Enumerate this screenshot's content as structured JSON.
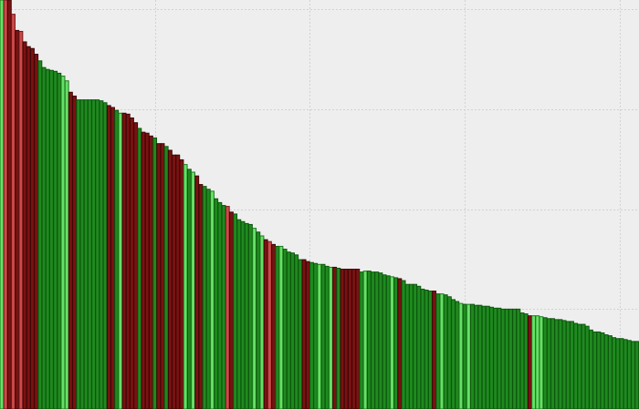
{
  "chart_data": {
    "type": "bar",
    "title": "",
    "xlabel": "",
    "ylabel": "",
    "ylim": [
      0,
      430
    ],
    "xlim": [
      0,
      165
    ],
    "grid": true,
    "x_grid_values": [
      0,
      40,
      80,
      120,
      160
    ],
    "y_grid_values": [
      105,
      210,
      315,
      420
    ],
    "legend": "none",
    "palette": {
      "dark_green": "#1f8a1f",
      "light_green": "#66e066",
      "dark_red": "#7a1212",
      "light_red": "#cc4a4a"
    },
    "bars": [
      {
        "value": 447,
        "color": "light_green"
      },
      {
        "value": 440,
        "color": "light_red"
      },
      {
        "value": 430,
        "color": "dark_red"
      },
      {
        "value": 415,
        "color": "light_red"
      },
      {
        "value": 398,
        "color": "dark_red"
      },
      {
        "value": 397,
        "color": "light_red"
      },
      {
        "value": 386,
        "color": "dark_red"
      },
      {
        "value": 381,
        "color": "dark_red"
      },
      {
        "value": 379,
        "color": "dark_red"
      },
      {
        "value": 373,
        "color": "dark_red"
      },
      {
        "value": 366,
        "color": "dark_green"
      },
      {
        "value": 359,
        "color": "dark_green"
      },
      {
        "value": 357,
        "color": "dark_green"
      },
      {
        "value": 356,
        "color": "dark_green"
      },
      {
        "value": 355,
        "color": "dark_green"
      },
      {
        "value": 353,
        "color": "dark_green"
      },
      {
        "value": 350,
        "color": "light_green"
      },
      {
        "value": 345,
        "color": "light_green"
      },
      {
        "value": 333,
        "color": "dark_red"
      },
      {
        "value": 329,
        "color": "dark_red"
      },
      {
        "value": 325,
        "color": "dark_green"
      },
      {
        "value": 325,
        "color": "dark_green"
      },
      {
        "value": 325,
        "color": "dark_green"
      },
      {
        "value": 325,
        "color": "dark_green"
      },
      {
        "value": 325,
        "color": "dark_green"
      },
      {
        "value": 325,
        "color": "dark_green"
      },
      {
        "value": 324,
        "color": "dark_green"
      },
      {
        "value": 322,
        "color": "dark_green"
      },
      {
        "value": 319,
        "color": "dark_red"
      },
      {
        "value": 317,
        "color": "dark_red"
      },
      {
        "value": 314,
        "color": "dark_green"
      },
      {
        "value": 311,
        "color": "light_green"
      },
      {
        "value": 311,
        "color": "dark_red"
      },
      {
        "value": 310,
        "color": "dark_red"
      },
      {
        "value": 306,
        "color": "dark_red"
      },
      {
        "value": 301,
        "color": "dark_red"
      },
      {
        "value": 295,
        "color": "dark_green"
      },
      {
        "value": 291,
        "color": "dark_red"
      },
      {
        "value": 290,
        "color": "dark_red"
      },
      {
        "value": 287,
        "color": "dark_red"
      },
      {
        "value": 285,
        "color": "dark_green"
      },
      {
        "value": 279,
        "color": "dark_red"
      },
      {
        "value": 279,
        "color": "dark_red"
      },
      {
        "value": 276,
        "color": "dark_green"
      },
      {
        "value": 272,
        "color": "dark_red"
      },
      {
        "value": 267,
        "color": "dark_red"
      },
      {
        "value": 267,
        "color": "dark_red"
      },
      {
        "value": 262,
        "color": "dark_red"
      },
      {
        "value": 257,
        "color": "light_green"
      },
      {
        "value": 252,
        "color": "dark_green"
      },
      {
        "value": 249,
        "color": "light_green"
      },
      {
        "value": 245,
        "color": "dark_red"
      },
      {
        "value": 236,
        "color": "dark_red"
      },
      {
        "value": 234,
        "color": "dark_green"
      },
      {
        "value": 231,
        "color": "dark_green"
      },
      {
        "value": 229,
        "color": "light_green"
      },
      {
        "value": 221,
        "color": "dark_green"
      },
      {
        "value": 217,
        "color": "dark_green"
      },
      {
        "value": 214,
        "color": "dark_green"
      },
      {
        "value": 213,
        "color": "light_red"
      },
      {
        "value": 207,
        "color": "dark_red"
      },
      {
        "value": 205,
        "color": "dark_green"
      },
      {
        "value": 199,
        "color": "dark_green"
      },
      {
        "value": 197,
        "color": "dark_green"
      },
      {
        "value": 195,
        "color": "dark_green"
      },
      {
        "value": 194,
        "color": "dark_green"
      },
      {
        "value": 190,
        "color": "light_green"
      },
      {
        "value": 186,
        "color": "dark_green"
      },
      {
        "value": 182,
        "color": "light_green"
      },
      {
        "value": 178,
        "color": "dark_red"
      },
      {
        "value": 176,
        "color": "light_red"
      },
      {
        "value": 173,
        "color": "dark_red"
      },
      {
        "value": 171,
        "color": "dark_green"
      },
      {
        "value": 171,
        "color": "light_green"
      },
      {
        "value": 168,
        "color": "dark_green"
      },
      {
        "value": 165,
        "color": "dark_green"
      },
      {
        "value": 164,
        "color": "dark_green"
      },
      {
        "value": 162,
        "color": "dark_green"
      },
      {
        "value": 157,
        "color": "dark_green"
      },
      {
        "value": 157,
        "color": "dark_red"
      },
      {
        "value": 155,
        "color": "dark_red"
      },
      {
        "value": 154,
        "color": "dark_green"
      },
      {
        "value": 153,
        "color": "dark_green"
      },
      {
        "value": 152,
        "color": "light_green"
      },
      {
        "value": 152,
        "color": "dark_green"
      },
      {
        "value": 150,
        "color": "dark_green"
      },
      {
        "value": 149,
        "color": "light_green"
      },
      {
        "value": 149,
        "color": "dark_red"
      },
      {
        "value": 148,
        "color": "dark_green"
      },
      {
        "value": 147,
        "color": "dark_red"
      },
      {
        "value": 147,
        "color": "dark_red"
      },
      {
        "value": 147,
        "color": "dark_red"
      },
      {
        "value": 147,
        "color": "dark_red"
      },
      {
        "value": 147,
        "color": "dark_red"
      },
      {
        "value": 144,
        "color": "dark_green"
      },
      {
        "value": 145,
        "color": "light_green"
      },
      {
        "value": 145,
        "color": "dark_green"
      },
      {
        "value": 144,
        "color": "dark_green"
      },
      {
        "value": 144,
        "color": "dark_green"
      },
      {
        "value": 143,
        "color": "dark_green"
      },
      {
        "value": 141,
        "color": "dark_green"
      },
      {
        "value": 140,
        "color": "dark_green"
      },
      {
        "value": 139,
        "color": "light_green"
      },
      {
        "value": 138,
        "color": "dark_green"
      },
      {
        "value": 137,
        "color": "dark_red"
      },
      {
        "value": 135,
        "color": "dark_green"
      },
      {
        "value": 131,
        "color": "dark_green"
      },
      {
        "value": 131,
        "color": "dark_green"
      },
      {
        "value": 131,
        "color": "dark_green"
      },
      {
        "value": 129,
        "color": "dark_green"
      },
      {
        "value": 126,
        "color": "dark_green"
      },
      {
        "value": 125,
        "color": "dark_green"
      },
      {
        "value": 124,
        "color": "dark_green"
      },
      {
        "value": 124,
        "color": "dark_red"
      },
      {
        "value": 121,
        "color": "dark_green"
      },
      {
        "value": 121,
        "color": "light_green"
      },
      {
        "value": 120,
        "color": "dark_green"
      },
      {
        "value": 118,
        "color": "dark_green"
      },
      {
        "value": 115,
        "color": "dark_green"
      },
      {
        "value": 113,
        "color": "dark_green"
      },
      {
        "value": 111,
        "color": "light_green"
      },
      {
        "value": 110,
        "color": "dark_green"
      },
      {
        "value": 110,
        "color": "light_green"
      },
      {
        "value": 110,
        "color": "dark_green"
      },
      {
        "value": 109,
        "color": "dark_green"
      },
      {
        "value": 109,
        "color": "dark_green"
      },
      {
        "value": 108,
        "color": "dark_green"
      },
      {
        "value": 108,
        "color": "dark_green"
      },
      {
        "value": 107,
        "color": "dark_green"
      },
      {
        "value": 106,
        "color": "dark_green"
      },
      {
        "value": 106,
        "color": "dark_green"
      },
      {
        "value": 105,
        "color": "dark_green"
      },
      {
        "value": 105,
        "color": "dark_green"
      },
      {
        "value": 105,
        "color": "dark_green"
      },
      {
        "value": 105,
        "color": "dark_green"
      },
      {
        "value": 105,
        "color": "dark_green"
      },
      {
        "value": 101,
        "color": "dark_green"
      },
      {
        "value": 100,
        "color": "dark_green"
      },
      {
        "value": 98,
        "color": "dark_red"
      },
      {
        "value": 98,
        "color": "light_green"
      },
      {
        "value": 98,
        "color": "light_green"
      },
      {
        "value": 97,
        "color": "light_green"
      },
      {
        "value": 96,
        "color": "dark_green"
      },
      {
        "value": 95,
        "color": "dark_green"
      },
      {
        "value": 95,
        "color": "dark_green"
      },
      {
        "value": 94,
        "color": "dark_green"
      },
      {
        "value": 94,
        "color": "dark_green"
      },
      {
        "value": 93,
        "color": "dark_green"
      },
      {
        "value": 92,
        "color": "dark_green"
      },
      {
        "value": 92,
        "color": "dark_green"
      },
      {
        "value": 90,
        "color": "dark_green"
      },
      {
        "value": 89,
        "color": "dark_green"
      },
      {
        "value": 89,
        "color": "dark_green"
      },
      {
        "value": 87,
        "color": "dark_green"
      },
      {
        "value": 83,
        "color": "dark_green"
      },
      {
        "value": 81,
        "color": "dark_green"
      },
      {
        "value": 81,
        "color": "dark_green"
      },
      {
        "value": 80,
        "color": "dark_green"
      },
      {
        "value": 78,
        "color": "dark_green"
      },
      {
        "value": 77,
        "color": "dark_green"
      },
      {
        "value": 75,
        "color": "dark_green"
      },
      {
        "value": 74,
        "color": "dark_green"
      },
      {
        "value": 74,
        "color": "dark_green"
      },
      {
        "value": 73,
        "color": "dark_green"
      },
      {
        "value": 72,
        "color": "dark_green"
      },
      {
        "value": 71,
        "color": "dark_green"
      },
      {
        "value": 71,
        "color": "dark_green"
      }
    ]
  }
}
